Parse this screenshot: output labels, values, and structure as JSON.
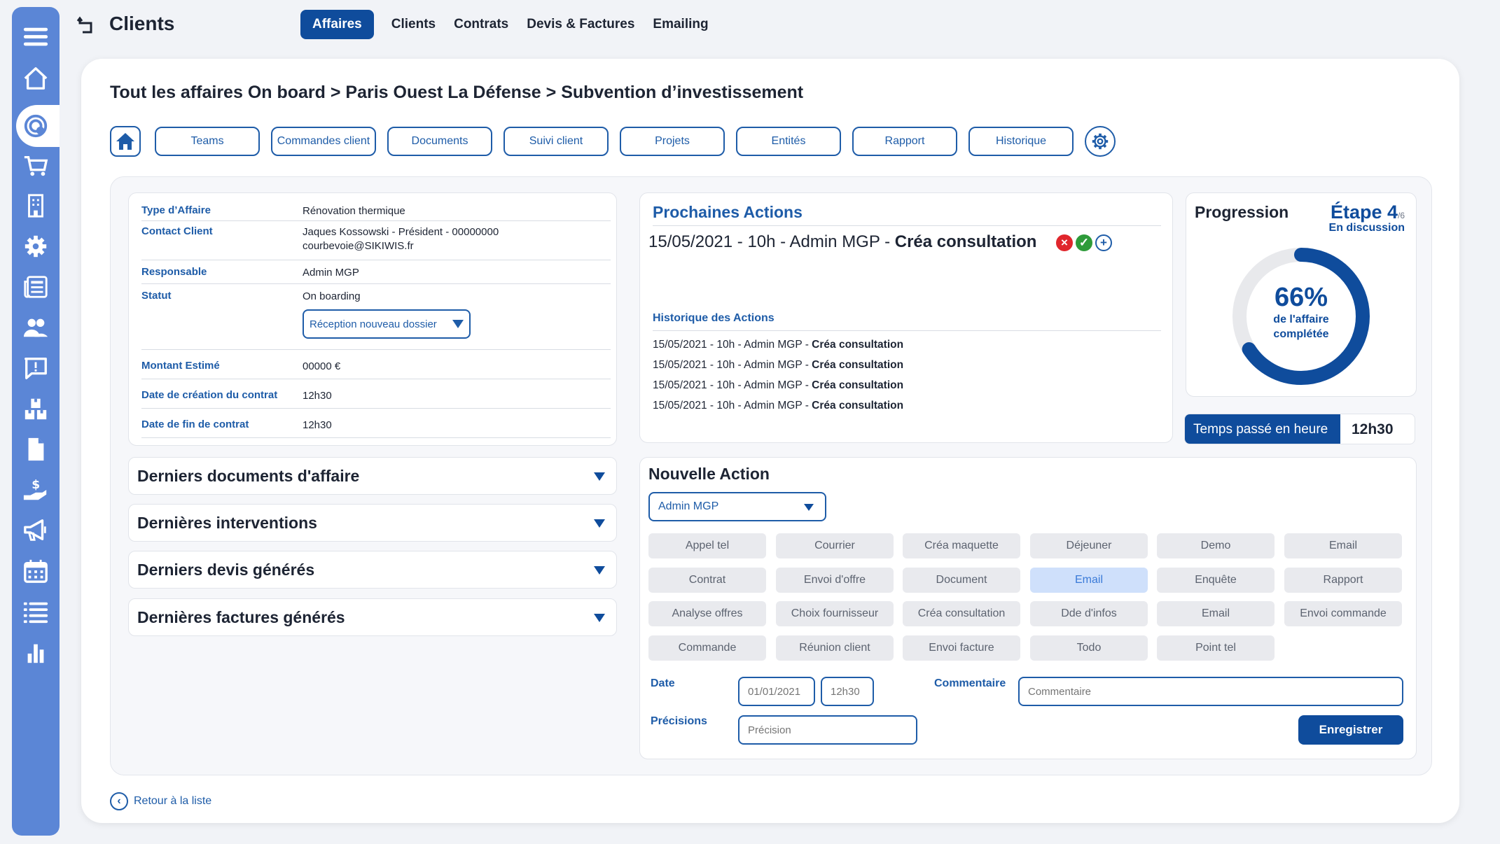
{
  "app": {
    "title": "Clients"
  },
  "nav": {
    "tabs": [
      "Affaires",
      "Clients",
      "Contrats",
      "Devis & Factures",
      "Emailing"
    ]
  },
  "breadcrumb": "Tout les affaires On board >  Paris Ouest La Défense > Subvention d’investissement",
  "tabs": [
    "Teams",
    "Commandes client",
    "Documents",
    "Suivi client",
    "Projets",
    "Entités",
    "Rapport",
    "Historique"
  ],
  "info": {
    "type_label": "Type d’Affaire",
    "type_value": "Rénovation thermique",
    "contact_label": "Contact Client",
    "contact_line1": "Jaques Kossowski - Président - 00000000",
    "contact_line2": "courbevoie@SIKIWIS.fr",
    "resp_label": "Responsable",
    "resp_value": "Admin MGP",
    "statut_label": "Statut",
    "statut_value": "On boarding",
    "statut_select": "Réception nouveau dossier",
    "montant_label": "Montant Estimé",
    "montant_value": "00000 €",
    "creation_label": "Date de création du contrat",
    "creation_value": "12h30",
    "fin_label": "Date de fin de contrat",
    "fin_value": "12h30"
  },
  "accordions": [
    "Derniers documents d'affaire",
    "Dernières interventions",
    "Derniers devis générés",
    "Dernières factures générés"
  ],
  "actions": {
    "title": "Prochaines Actions",
    "next_prefix": "15/05/2021 - 10h - Admin MGP - ",
    "next_bold": "Créa consultation",
    "history_title": "Historique des Actions",
    "history": [
      {
        "prefix": "15/05/2021 - 10h - Admin MGP - ",
        "bold": "Créa consultation"
      },
      {
        "prefix": "15/05/2021 - 10h - Admin MGP - ",
        "bold": "Créa consultation"
      },
      {
        "prefix": "15/05/2021 - 10h - Admin MGP - ",
        "bold": "Créa consultation"
      },
      {
        "prefix": "15/05/2021 - 10h - Admin MGP - ",
        "bold": "Créa consultation"
      }
    ]
  },
  "progression": {
    "title": "Progression",
    "etape": "Étape 4",
    "etape_total": "/6",
    "etape_status": "En discussion",
    "percent": 66,
    "percent_label": "66%",
    "caption1": "de l'affaire",
    "caption2": "complétée",
    "time_label": "Temps passé en heure",
    "time_value": "12h30"
  },
  "new_action": {
    "title": "Nouvelle Action",
    "assignee": "Admin MGP",
    "chips": [
      [
        "Appel tel",
        "Courrier",
        "Créa maquette",
        "Déjeuner",
        "Demo",
        "Email"
      ],
      [
        "Contrat",
        "Envoi d'offre",
        "Document",
        "Email",
        "Enquête",
        "Rapport"
      ],
      [
        "Analyse offres",
        "Choix fournisseur",
        "Créa consultation",
        "Dde d'infos",
        "Email",
        "Envoi commande"
      ],
      [
        "Commande",
        "Réunion client",
        "Envoi facture",
        "Todo",
        "Point tel"
      ]
    ],
    "date_label": "Date",
    "date_placeholder": "01/01/2021",
    "time_placeholder": "12h30",
    "comment_label": "Commentaire",
    "comment_placeholder": "Commentaire",
    "precision_label": "Précisions",
    "precision_placeholder": "Précision",
    "save": "Enregistrer"
  },
  "back": "Retour à la liste",
  "colors": {
    "primary": "#0f4c9c",
    "sidebar": "#5b86d6",
    "selected_chip": "#cfe0fb"
  }
}
